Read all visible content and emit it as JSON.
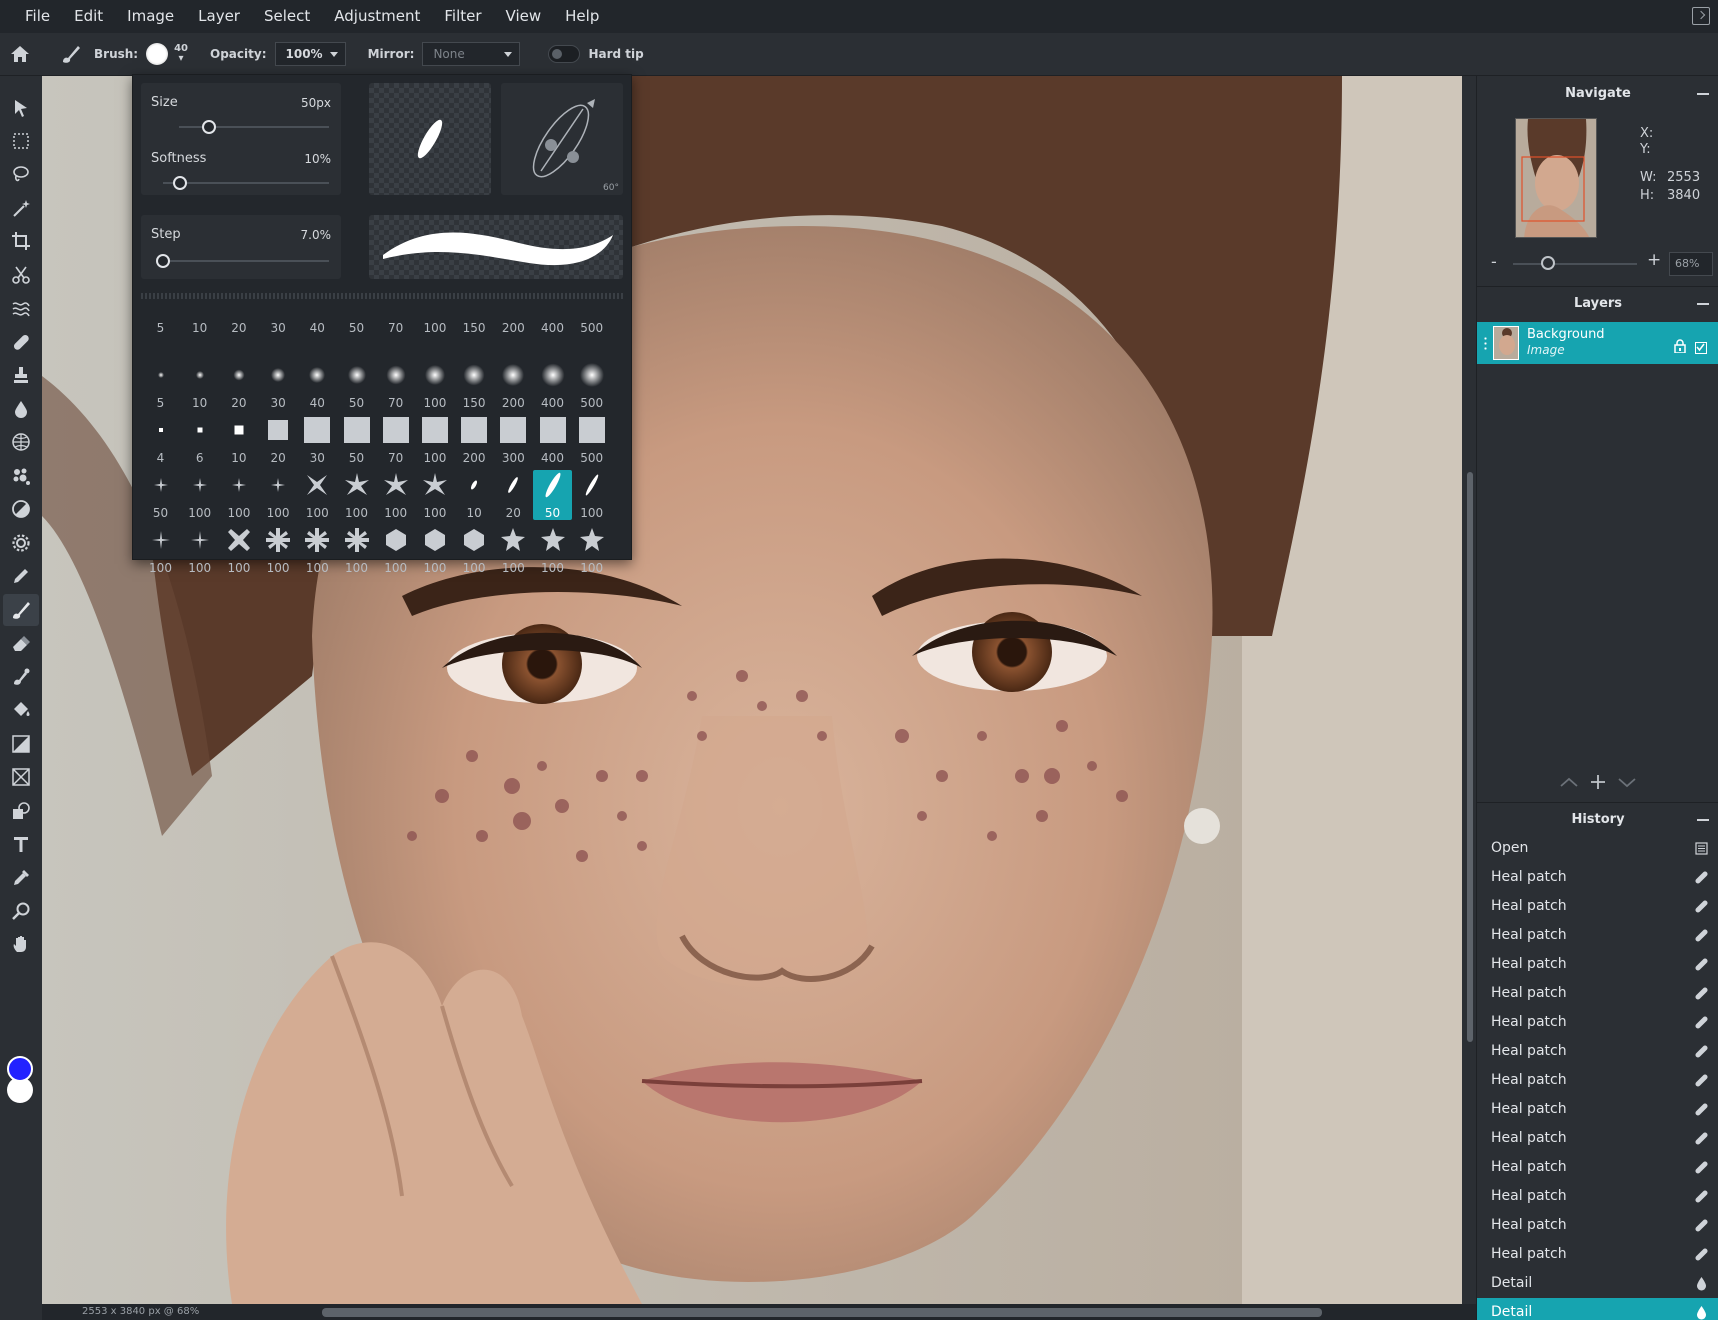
{
  "menu": [
    "File",
    "Edit",
    "Image",
    "Layer",
    "Select",
    "Adjustment",
    "Filter",
    "View",
    "Help"
  ],
  "options": {
    "brush_label": "Brush:",
    "brush_size": "40",
    "opacity_label": "Opacity:",
    "opacity_value": "100%",
    "mirror_label": "Mirror:",
    "mirror_value": "None",
    "hard_tip_label": "Hard tip",
    "hard_tip": false
  },
  "tools": [
    "select-arrow-icon",
    "marquee-icon",
    "lasso-icon",
    "magic-wand-icon",
    "crop-icon",
    "scissors-icon",
    "liquify-icon",
    "bandage-icon",
    "stamp-icon",
    "drop-icon",
    "sphere-icon",
    "sponge-icon",
    "dodge-icon",
    "gear-icon",
    "pencil-icon",
    "brush-icon",
    "eraser-icon",
    "smudge-icon",
    "bucket-icon",
    "gradient-icon",
    "frame-icon",
    "shapes-icon",
    "type-icon",
    "eyedropper-icon",
    "zoom-icon",
    "hand-icon"
  ],
  "active_tool": "brush-icon",
  "colors": {
    "foreground": "#2222ff",
    "background": "#ffffff",
    "accent": "#16a4b0"
  },
  "brush_panel": {
    "size_label": "Size",
    "size_value": "50px",
    "size_fraction": 0.2,
    "softness_label": "Softness",
    "softness_value": "10%",
    "softness_fraction": 0.1,
    "step_label": "Step",
    "step_value": "7.0%",
    "step_fraction": 0.0,
    "angle_value": "60°",
    "rows": [
      {
        "shape": "label",
        "sizes": [
          "5",
          "10",
          "20",
          "30",
          "40",
          "50",
          "70",
          "100",
          "150",
          "200",
          "400",
          "500"
        ]
      },
      {
        "shape": "soft-dot",
        "sizes": [
          "5",
          "10",
          "20",
          "30",
          "40",
          "50",
          "70",
          "100",
          "150",
          "200",
          "400",
          "500"
        ]
      },
      {
        "shape": "square",
        "sizes": [
          "4",
          "6",
          "10",
          "20",
          "30",
          "50",
          "70",
          "100",
          "200",
          "300",
          "400",
          "500"
        ]
      },
      {
        "shape": "star-mix",
        "sizes": [
          "50",
          "100",
          "100",
          "100",
          "100",
          "100",
          "100",
          "100",
          "10",
          "20",
          "50",
          "100"
        ]
      },
      {
        "shape": "shape-mix",
        "sizes": [
          "100",
          "100",
          "100",
          "100",
          "100",
          "100",
          "100",
          "100",
          "100",
          "100",
          "100",
          "100"
        ]
      }
    ],
    "selected": {
      "row": 3,
      "col": 10
    }
  },
  "navigate": {
    "title": "Navigate",
    "x_label": "X:",
    "y_label": "Y:",
    "x_value": "",
    "y_value": "",
    "w_label": "W:",
    "w_value": "2553",
    "h_label": "H:",
    "h_value": "3840",
    "zoom_minus": "-",
    "zoom_plus": "+",
    "zoom": "68%"
  },
  "layers": {
    "title": "Layers",
    "items": [
      {
        "name": "Background",
        "type": "Image",
        "locked": true,
        "visible": true
      }
    ]
  },
  "history": {
    "title": "History",
    "items": [
      {
        "label": "Open",
        "icon": "document-icon"
      },
      {
        "label": "Heal patch",
        "icon": "bandage-icon"
      },
      {
        "label": "Heal patch",
        "icon": "bandage-icon"
      },
      {
        "label": "Heal patch",
        "icon": "bandage-icon"
      },
      {
        "label": "Heal patch",
        "icon": "bandage-icon"
      },
      {
        "label": "Heal patch",
        "icon": "bandage-icon"
      },
      {
        "label": "Heal patch",
        "icon": "bandage-icon"
      },
      {
        "label": "Heal patch",
        "icon": "bandage-icon"
      },
      {
        "label": "Heal patch",
        "icon": "bandage-icon"
      },
      {
        "label": "Heal patch",
        "icon": "bandage-icon"
      },
      {
        "label": "Heal patch",
        "icon": "bandage-icon"
      },
      {
        "label": "Heal patch",
        "icon": "bandage-icon"
      },
      {
        "label": "Heal patch",
        "icon": "bandage-icon"
      },
      {
        "label": "Heal patch",
        "icon": "bandage-icon"
      },
      {
        "label": "Heal patch",
        "icon": "bandage-icon"
      },
      {
        "label": "Detail",
        "icon": "drop-icon"
      },
      {
        "label": "Detail",
        "icon": "drop-icon"
      }
    ],
    "active_index": 16
  },
  "status": {
    "text": "2553 x 3840 px @ 68%"
  }
}
